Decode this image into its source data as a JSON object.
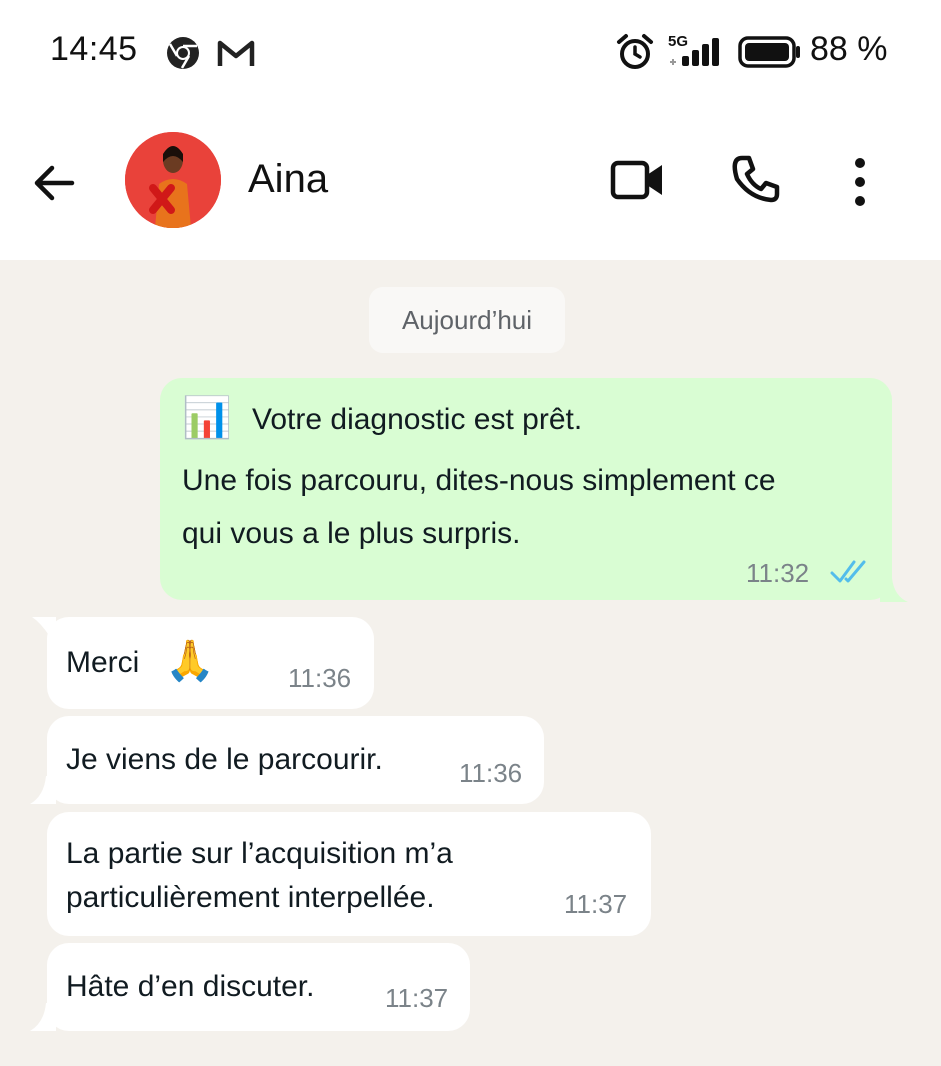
{
  "status_bar": {
    "time": "14:45",
    "battery_pct": "88 %",
    "network": "5G",
    "icons": [
      "chrome-icon",
      "gmail-icon",
      "alarm-icon",
      "signal-icon",
      "battery-icon"
    ]
  },
  "header": {
    "contact_name": "Aina",
    "icons": [
      "back-arrow-icon",
      "video-call-icon",
      "phone-icon",
      "more-vert-icon"
    ]
  },
  "chat": {
    "date_label": "Aujourd’hui",
    "messages": [
      {
        "direction": "out",
        "line1": "Votre diagnostic est prêt.",
        "line2": "Une fois parcouru, dites-nous simplement ce",
        "line3": "qui vous a le plus surpris.",
        "emoji": "📊",
        "time": "11:32",
        "status": "read"
      },
      {
        "direction": "in",
        "text": "Merci",
        "emoji": "🙏",
        "time": "11:36"
      },
      {
        "direction": "in",
        "text": "Je viens de le parcourir.",
        "time": "11:36"
      },
      {
        "direction": "in",
        "line1": "La partie sur l’acquisition m’a",
        "line2": "particulièrement interpellée.",
        "time": "11:37"
      },
      {
        "direction": "in",
        "text": "Hâte d’en discuter.",
        "time": "11:37"
      }
    ]
  },
  "colors": {
    "outgoing_bubble": "#d9fdd3",
    "incoming_bubble": "#ffffff",
    "chat_background": "#f4f1ec",
    "read_ticks": "#53bdeb"
  }
}
